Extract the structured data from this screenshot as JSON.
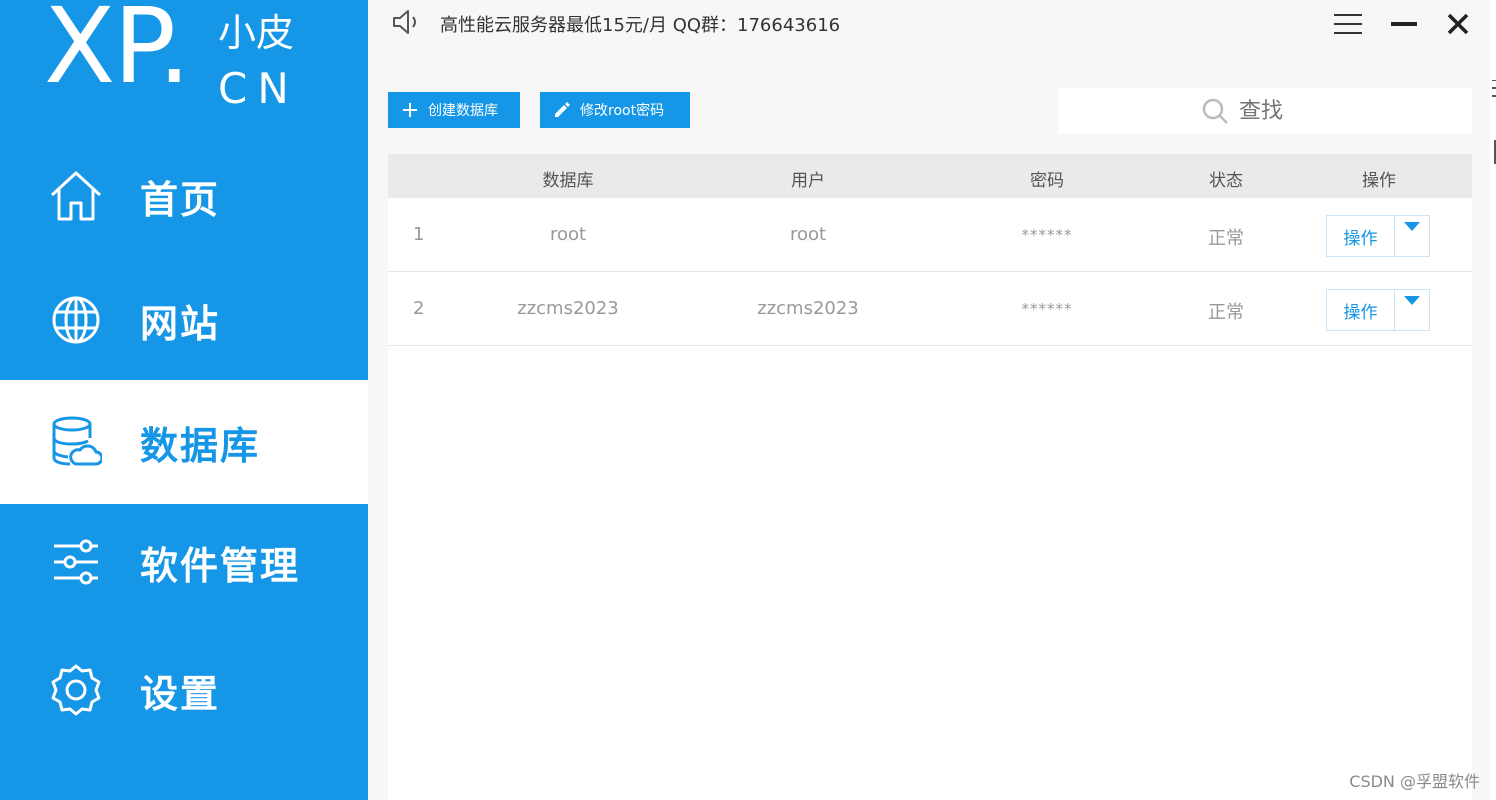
{
  "sidebar": {
    "logo": {
      "main": "XP.",
      "top": "小皮",
      "bottom": "CN"
    },
    "items": [
      {
        "label": "首页",
        "icon": "home-icon"
      },
      {
        "label": "网站",
        "icon": "globe-icon"
      },
      {
        "label": "数据库",
        "icon": "database-icon",
        "active": true
      },
      {
        "label": "软件管理",
        "icon": "sliders-icon"
      },
      {
        "label": "设置",
        "icon": "gear-icon"
      }
    ]
  },
  "titlebar": {
    "notice": "高性能云服务器最低15元/月  QQ群：176643616",
    "icons": [
      "speaker-icon",
      "menu-icon",
      "minimize-icon",
      "close-icon"
    ]
  },
  "toolbar": {
    "create_label": "创建数据库",
    "change_password_label": "修改root密码",
    "search_placeholder": "查找"
  },
  "table": {
    "columns": [
      "数据库",
      "用户",
      "密码",
      "状态",
      "操作"
    ],
    "rows": [
      {
        "index": "1",
        "database": "root",
        "user": "root",
        "password": "******",
        "status": "正常",
        "action": "操作"
      },
      {
        "index": "2",
        "database": "zzcms2023",
        "user": "zzcms2023",
        "password": "******",
        "status": "正常",
        "action": "操作"
      }
    ]
  },
  "watermark": "CSDN @孚盟软件",
  "colors": {
    "accent": "#1596e6",
    "header_bg": "#eaeaea",
    "muted_text": "#999999"
  }
}
